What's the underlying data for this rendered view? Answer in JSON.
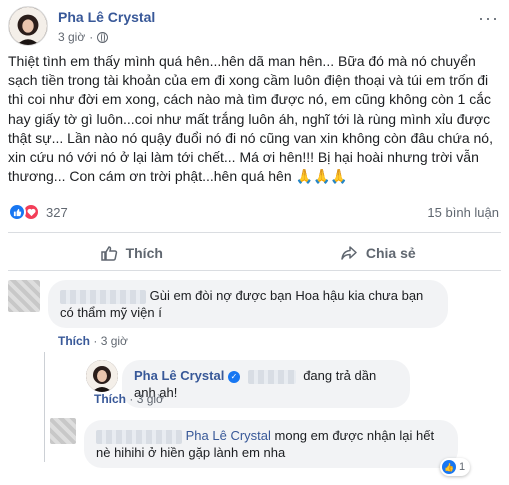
{
  "post": {
    "author": "Pha Lê Crystal",
    "time": "3 giờ",
    "body": "Thiệt tình em thấy mình quá hên...hên dã man hên... Bữa đó mà nó chuyển sạch tiền trong tài khoản của em đi xong cầm luôn điện thoại và túi em trốn đi thì coi như đời em xong, cách nào mà tìm được nó, em cũng không còn 1 cắc hay giấy tờ gì luôn...coi như mất trắng luôn áh, nghĩ tới là rùng mình xỉu được thật sự... Lần nào nó quậy đuổi nó đi nó cũng van xin không còn đâu chứa nó, xin cứu nó với nó ở lại làm tới chết... Má ơi hên!!! Bị hại hoài nhưng trời vẫn thương... Con cám ơn trời phật...hên quá hên 🙏🙏🙏",
    "reaction_count": "327",
    "comment_count": "15 bình luận"
  },
  "actions": {
    "like": "Thích",
    "share": "Chia sẻ"
  },
  "comments": [
    {
      "text": "Gùi em đòi nợ được bạn Hoa hậu kia chưa bạn có thẩm mỹ viện í",
      "like_label": "Thích",
      "time": "3 giờ"
    },
    {
      "author": "Pha Lê Crystal",
      "text": "đang trả dần anh ah!",
      "like_label": "Thích",
      "time": "3 giờ"
    },
    {
      "mention": "Pha Lê Crystal",
      "text": "mong em được nhận lại hết nè hihihi ở hiền gặp lành em nha",
      "like_count": "1"
    }
  ]
}
